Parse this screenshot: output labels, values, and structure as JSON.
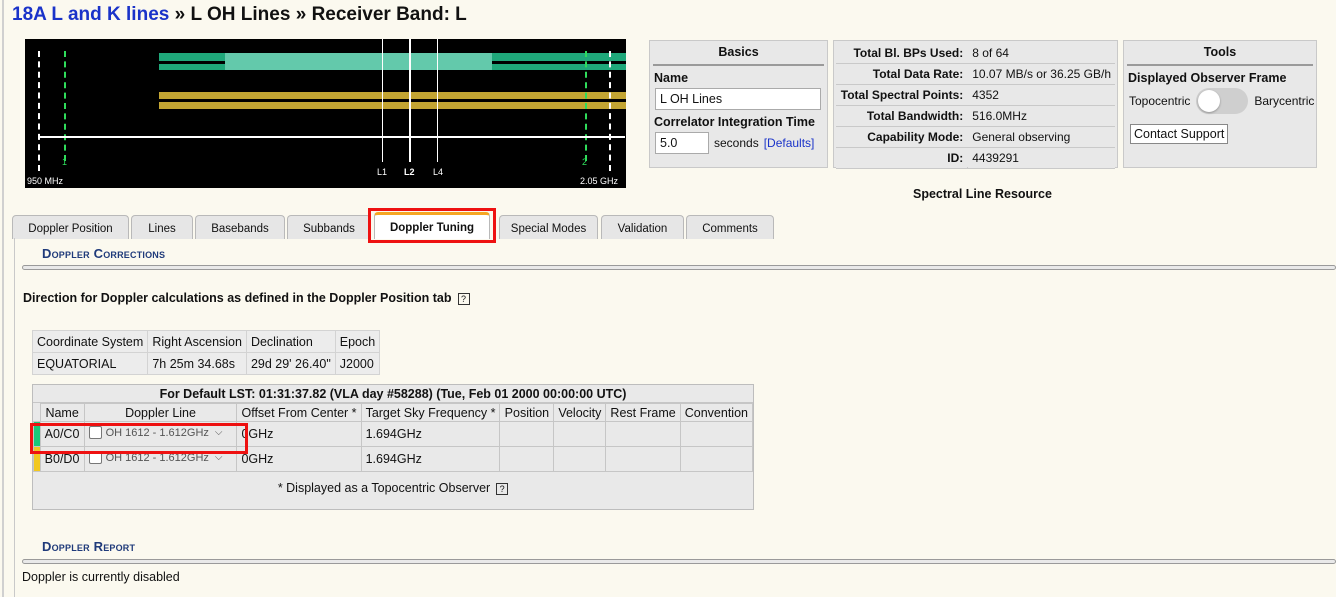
{
  "header": {
    "project": "18A L and K lines",
    "sep1": "»",
    "config": "L OH Lines",
    "sep2": "»",
    "band": "Receiver Band: L"
  },
  "spectrum": {
    "left_freq": "950 MHz",
    "right_freq": "2.05 GHz",
    "marker_left": "1",
    "marker_right": "2",
    "line_labels": [
      "L1",
      "L2",
      "L4"
    ],
    "colors": {
      "baseband_a": "#1fa87a",
      "subband_highlight": "#63c9ab",
      "baseband_b": "#c3a533",
      "marker": "#2fdc5b"
    }
  },
  "basics": {
    "title": "Basics",
    "name_label": "Name",
    "name_value": "L OH Lines",
    "integration_label": "Correlator Integration Time",
    "integration_value": "5.0",
    "integration_unit": "seconds",
    "defaults_link": "[Defaults]"
  },
  "stats": [
    {
      "key": "Total Bl. BPs Used:",
      "value": "8 of 64"
    },
    {
      "key": "Total Data Rate:",
      "value": "10.07 MB/s or 36.25 GB/h"
    },
    {
      "key": "Total Spectral Points:",
      "value": "4352"
    },
    {
      "key": "Total Bandwidth:",
      "value": "516.0MHz"
    },
    {
      "key": "Capability Mode:",
      "value": "General observing"
    },
    {
      "key": "ID:",
      "value": "4439291"
    }
  ],
  "tools": {
    "title": "Tools",
    "frame_label": "Displayed Observer Frame",
    "left_option": "Topocentric",
    "right_option": "Barycentric",
    "contact_button": "Contact Support"
  },
  "spectral_line_resource": "Spectral Line Resource",
  "tabs": [
    {
      "label": "Doppler Position"
    },
    {
      "label": "Lines"
    },
    {
      "label": "Basebands"
    },
    {
      "label": "Subbands"
    },
    {
      "label": "Doppler Tuning",
      "active": true
    },
    {
      "label": "Special Modes"
    },
    {
      "label": "Validation"
    },
    {
      "label": "Comments"
    }
  ],
  "doppler_corrections": {
    "title": "Doppler Corrections",
    "direction_text": "Direction for Doppler calculations as defined in the Doppler Position tab",
    "help": "?",
    "coord_headers": [
      "Coordinate System",
      "Right Ascension",
      "Declination",
      "Epoch"
    ],
    "coord_values": [
      "EQUATORIAL",
      "7h 25m 34.68s",
      "29d 29' 26.40\"",
      "J2000"
    ],
    "table_title": "For Default LST: 01:31:37.82 (VLA day #58288) (Tue, Feb 01 2000 00:00:00 UTC)",
    "columns": [
      "Name",
      "Doppler Line",
      "Offset From Center *",
      "Target Sky Frequency *",
      "Position",
      "Velocity",
      "Rest Frame",
      "Convention"
    ],
    "rows": [
      {
        "color": "#19c97a",
        "name": "A0/C0",
        "line": "OH 1612 - 1.612GHz",
        "offset": "0GHz",
        "target": "1.694GHz"
      },
      {
        "color": "#f2c81f",
        "name": "B0/D0",
        "line": "OH 1612 - 1.612GHz",
        "offset": "0GHz",
        "target": "1.694GHz"
      }
    ],
    "footnote": "* Displayed as a Topocentric Observer"
  },
  "doppler_report": {
    "title": "Doppler Report",
    "text": "Doppler is currently disabled"
  }
}
